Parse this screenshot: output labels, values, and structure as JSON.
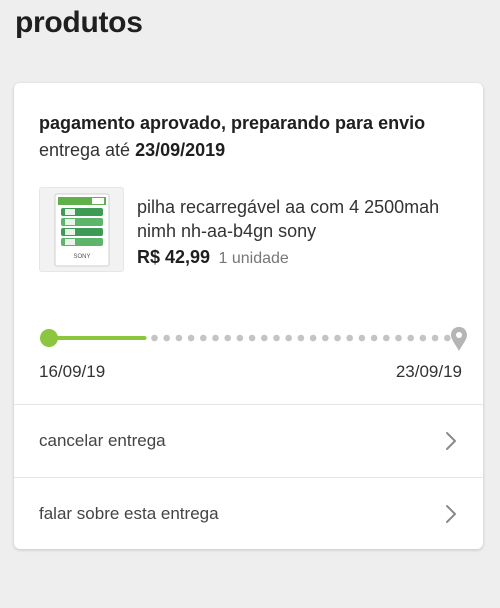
{
  "page": {
    "title": "produtos"
  },
  "order": {
    "status": "pagamento aprovado, preparando para envio",
    "delivery_prefix": "entrega até",
    "delivery_date": "23/09/2019"
  },
  "product": {
    "name": "pilha recarregável aa com 4 2500mah nimh nh-aa-b4gn sony",
    "price": "R$ 42,99",
    "quantity": "1 unidade",
    "brand_on_package": "SONY"
  },
  "tracking": {
    "start_date": "16/09/19",
    "end_date": "23/09/19",
    "progress": 0.24,
    "accent_color": "#8cc63f"
  },
  "actions": {
    "cancel_label": "cancelar entrega",
    "talk_label": "falar sobre esta entrega"
  }
}
